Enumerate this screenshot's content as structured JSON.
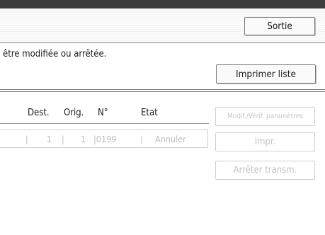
{
  "header": {
    "exit_label": "Sortie"
  },
  "message": "être modifiée ou arrêtée.",
  "print_list_label": "Imprimer liste",
  "list": {
    "columns": [
      "Dest.",
      "Orig.",
      "N°",
      "Etat"
    ],
    "rows": [
      {
        "sep1": "|",
        "dest": "1",
        "sep2": "|",
        "orig": "1",
        "num": "|0199",
        "sep3": "|",
        "state": "Annuler"
      }
    ]
  },
  "actions": {
    "modif_label": "Modif./Vérif. paramètres",
    "print_label": "Impr.",
    "stop_label": "Arrêter transm."
  },
  "colors": {
    "topbar": "#3c3c3c",
    "disabled_text": "#c4c4c4"
  }
}
